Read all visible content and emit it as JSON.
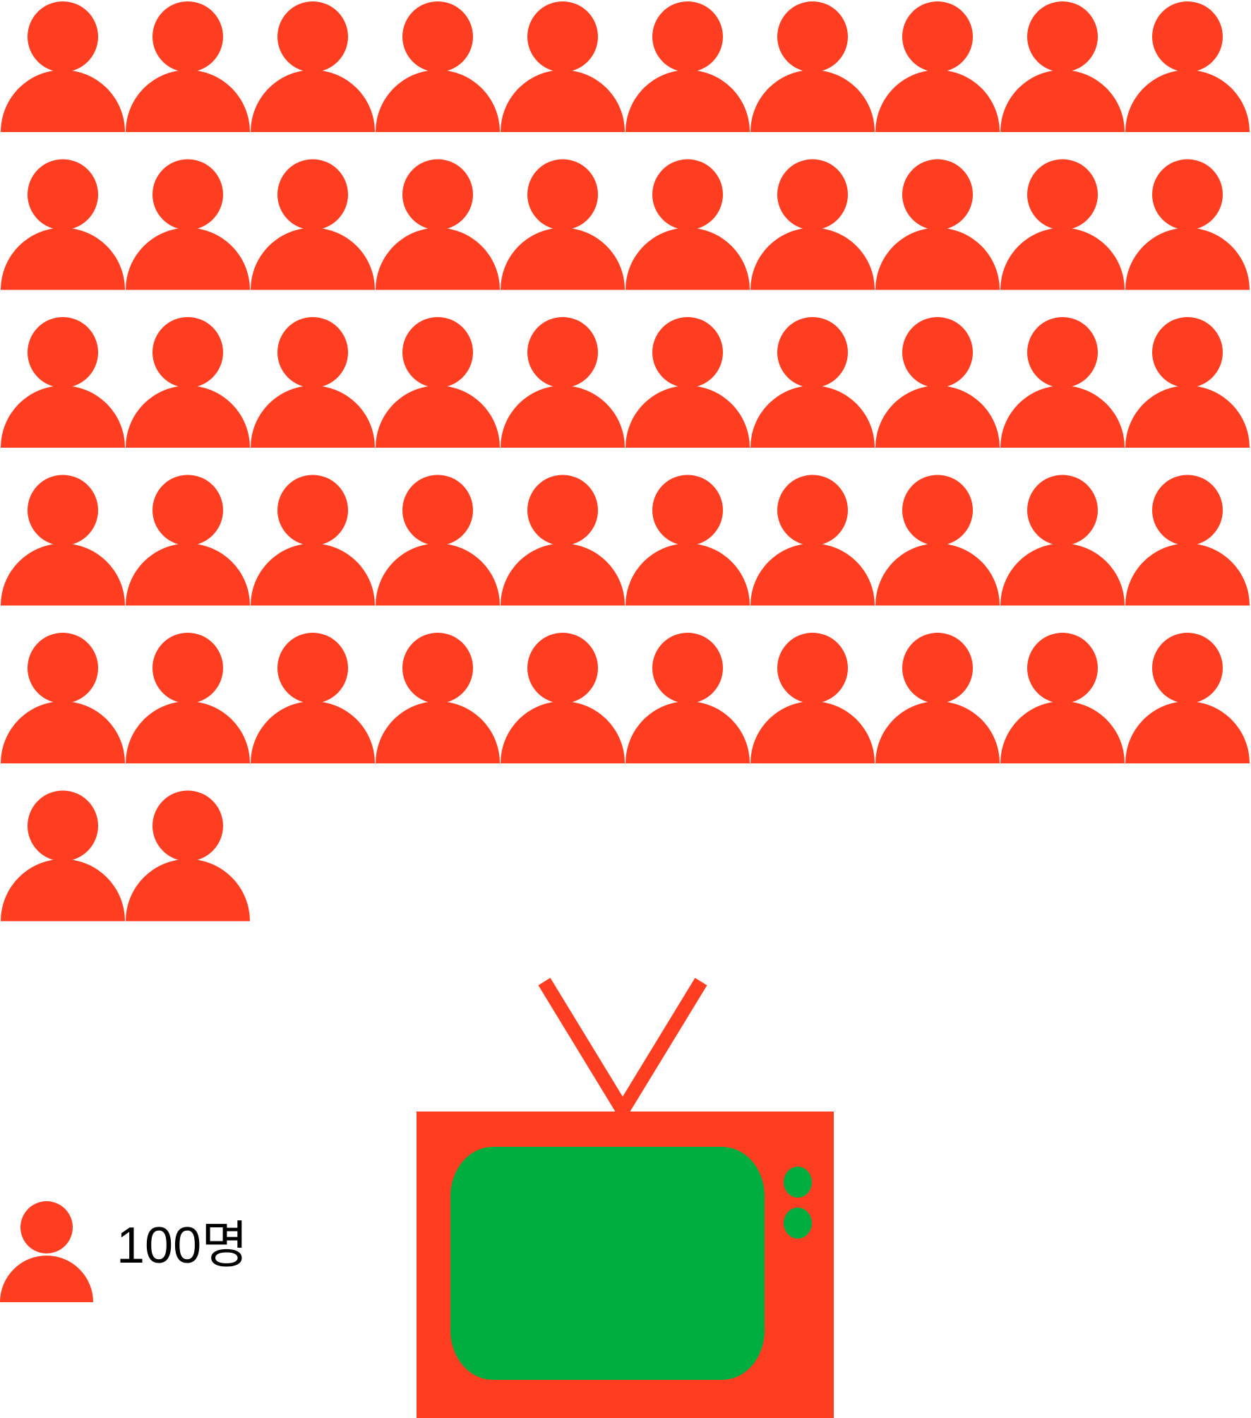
{
  "chart_data": {
    "type": "pictogram",
    "unit_label": "100명",
    "icon": "person-icon",
    "count": 52,
    "per_row": 10,
    "colors": {
      "icon": "#FF3D21",
      "tv_body": "#FF3D21",
      "tv_screen": "#00AD3F"
    }
  },
  "legend": {
    "icon": "person-icon",
    "label": "100명"
  },
  "illustration": {
    "icon": "television-icon"
  }
}
